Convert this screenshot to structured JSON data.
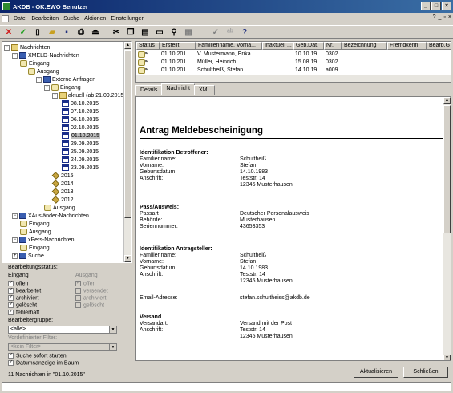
{
  "window": {
    "title": "AKDB - OK.EWO Benutzer"
  },
  "menu": {
    "items": [
      "Datei",
      "Bearbeiten",
      "Suche",
      "Aktionen",
      "Einstellungen"
    ],
    "help": "?"
  },
  "tree": {
    "items": [
      {
        "label": "Nachrichten",
        "icon": "folder"
      },
      {
        "label": "XMELD-Nachrichten",
        "icon": "xml"
      },
      {
        "label": "Eingang",
        "icon": "inbox"
      },
      {
        "label": "Ausgang",
        "icon": "inbox"
      },
      {
        "label": "Externe Anfragen",
        "icon": "xml"
      },
      {
        "label": "Eingang",
        "icon": "inbox"
      },
      {
        "label": "aktuell (ab 21.09.2015)",
        "icon": "folder"
      },
      {
        "label": "08.10.2015",
        "icon": "cal"
      },
      {
        "label": "07.10.2015",
        "icon": "cal"
      },
      {
        "label": "06.10.2015",
        "icon": "cal"
      },
      {
        "label": "02.10.2015",
        "icon": "cal"
      },
      {
        "label": "01.10.2015",
        "icon": "cal"
      },
      {
        "label": "29.09.2015",
        "icon": "cal"
      },
      {
        "label": "25.09.2015",
        "icon": "cal"
      },
      {
        "label": "24.09.2015",
        "icon": "cal"
      },
      {
        "label": "23.09.2015",
        "icon": "cal"
      },
      {
        "label": "2015",
        "icon": "cube"
      },
      {
        "label": "2014",
        "icon": "cube"
      },
      {
        "label": "2013",
        "icon": "cube"
      },
      {
        "label": "2012",
        "icon": "cube"
      },
      {
        "label": "Ausgang",
        "icon": "inbox"
      },
      {
        "label": "XAusländer-Nachrichten",
        "icon": "xml"
      },
      {
        "label": "Eingang",
        "icon": "inbox"
      },
      {
        "label": "Ausgang",
        "icon": "inbox"
      },
      {
        "label": "xPers-Nachrichten",
        "icon": "xml"
      },
      {
        "label": "Eingang",
        "icon": "inbox"
      },
      {
        "label": "Suche",
        "icon": "xml"
      }
    ]
  },
  "status_panel": {
    "heading": "Bearbeitungsstatus:",
    "col_in": "Eingang",
    "col_out": "Ausgang",
    "in": [
      "offen",
      "bearbeitet",
      "archiviert",
      "gelöscht",
      "fehlerhaft"
    ],
    "out": [
      "offen",
      "versendet",
      "archiviert",
      "gelöscht"
    ],
    "group_label": "Bearbeitergruppe:",
    "group_value": "<alle>",
    "filter_label": "Vordefinierter Filter:",
    "filter_value": "<kein Filter>",
    "search_now": "Suche sofort starten",
    "date_display": "Datumsanzeige im Baum"
  },
  "status_text": "11 Nachrichten in \"01.10.2015\"",
  "table": {
    "headers": [
      "Status",
      "Erstellt",
      "Familienname, Vorna...",
      "Inaktuell ...",
      "Geb.Dat.",
      "Nr.",
      "Bezeichnung",
      "Fremdkenn",
      "Bearb.G"
    ],
    "rows": [
      [
        "ei...",
        "01.10.201...",
        "V. Mustermann, Erika",
        "",
        "10.10.19...",
        "0302",
        "",
        "",
        ""
      ],
      [
        "ei...",
        "01.10.201...",
        "Müller, Heinrich",
        "",
        "15.08.19...",
        "0302",
        "",
        "",
        ""
      ],
      [
        "ei...",
        "01.10.201...",
        "Schultheiß, Stefan",
        "",
        "14.10.19...",
        "a009",
        "",
        "",
        ""
      ]
    ]
  },
  "tabs": [
    "Details",
    "Nachricht",
    "XML"
  ],
  "document": {
    "title": "Antrag Meldebescheinigung",
    "sec1": "Identifikation Betroffener:",
    "fields1": [
      [
        "Familienname:",
        "Schultheiß"
      ],
      [
        "Vorname:",
        "Stefan"
      ],
      [
        "Geburtsdatum:",
        "14.10.1983"
      ],
      [
        "Anschrift:",
        "Teststr. 14"
      ],
      [
        "",
        "12345 Musterhausen"
      ]
    ],
    "sec2": "Pass/Ausweis:",
    "fields2": [
      [
        "Passart",
        "Deutscher Personalausweis"
      ],
      [
        "Behörde:",
        "Musterhausen"
      ],
      [
        "Seriennummer:",
        "43653353"
      ]
    ],
    "sec3": "Identifikation Antragsteller:",
    "fields3": [
      [
        "Familienname:",
        "Schultheiß"
      ],
      [
        "Vorname:",
        "Stefan"
      ],
      [
        "Geburtsdatum:",
        "14.10.1983"
      ],
      [
        "Anschrift:",
        "Teststr. 14"
      ],
      [
        "",
        "12345 Musterhausen"
      ]
    ],
    "email_label": "Email-Adresse:",
    "email_value": "stefan.schultheiss@akdb.de",
    "sec4": "Versand",
    "fields4": [
      [
        "Versandart:",
        "Versand mit der Post"
      ],
      [
        "Anschrift:",
        "Teststr. 14"
      ],
      [
        "",
        "12345 Musterhausen"
      ]
    ]
  },
  "buttons": {
    "refresh": "Aktualisieren",
    "close": "Schließen"
  }
}
